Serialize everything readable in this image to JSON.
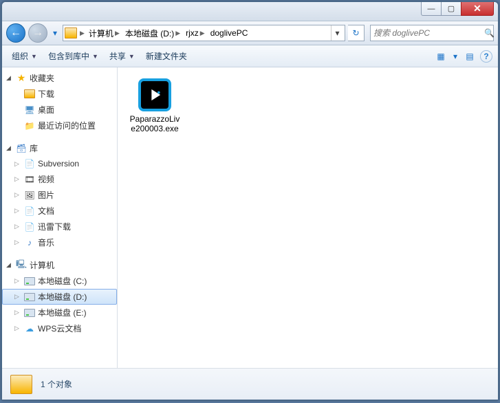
{
  "titlebar": {
    "min": "—",
    "max": "▢",
    "close": "✕"
  },
  "nav": {
    "back": "←",
    "forward": "→",
    "dropdown": "▾",
    "crumbs": [
      "计算机",
      "本地磁盘 (D:)",
      "rjxz",
      "doglivePC"
    ],
    "addr_dropdown": "▾",
    "refresh": "↻"
  },
  "search": {
    "placeholder": "搜索 doglivePC",
    "icon": "🔍"
  },
  "toolbar": {
    "organize": "组织",
    "include": "包含到库中",
    "share": "共享",
    "new_folder": "新建文件夹",
    "view_icon": "▦",
    "view_drop": "▾",
    "preview_icon": "▤",
    "help_icon": "?"
  },
  "sidebar": {
    "favorites": {
      "label": "收藏夹",
      "items": [
        {
          "label": "下载",
          "icon": "folder"
        },
        {
          "label": "桌面",
          "icon": "desktop"
        },
        {
          "label": "最近访问的位置",
          "icon": "recent"
        }
      ]
    },
    "libraries": {
      "label": "库",
      "items": [
        {
          "label": "Subversion",
          "icon": "doc"
        },
        {
          "label": "视频",
          "icon": "video"
        },
        {
          "label": "图片",
          "icon": "picture"
        },
        {
          "label": "文档",
          "icon": "doc"
        },
        {
          "label": "迅雷下载",
          "icon": "doc"
        },
        {
          "label": "音乐",
          "icon": "music"
        }
      ]
    },
    "computer": {
      "label": "计算机",
      "items": [
        {
          "label": "本地磁盘 (C:)",
          "icon": "drive",
          "selected": false
        },
        {
          "label": "本地磁盘 (D:)",
          "icon": "drive",
          "selected": true
        },
        {
          "label": "本地磁盘 (E:)",
          "icon": "drive",
          "selected": false
        },
        {
          "label": "WPS云文档",
          "icon": "cloud",
          "selected": false
        }
      ]
    }
  },
  "files": [
    {
      "name": "PaparazzoLive200003.exe"
    }
  ],
  "status": {
    "text": "1 个对象"
  }
}
